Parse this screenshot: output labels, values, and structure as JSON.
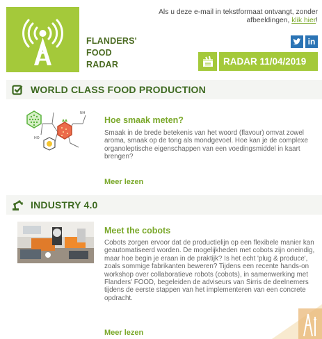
{
  "header": {
    "brand_lines": [
      "FLANDERS'",
      "FOOD",
      "RADAR"
    ],
    "notice_text": "Als u deze e-mail in tekstformaat ontvangt, zonder afbeeldingen,",
    "notice_link": "klik hier",
    "notice_suffix": "!",
    "social": [
      {
        "icon": "twitter-icon",
        "glyph": "🐦"
      },
      {
        "icon": "linkedin-icon",
        "glyph": "in"
      }
    ],
    "radar_label": "RADAR 11/04/2019",
    "logo_icon": "antenna-icon",
    "radar_icon": "calendar-icon"
  },
  "sections": [
    {
      "title": "WORLD CLASS FOOD PRODUCTION",
      "icon": "checkbox-icon",
      "article": {
        "title": "Hoe smaak meten?",
        "body": "Smaak in de brede betekenis van het woord (flavour) omvat zowel aroma, smaak op de tong als mondgevoel. Hoe kan je de complexe organoleptische eigenschappen van een voedingsmiddel in kaart brengen?",
        "more": "Meer lezen"
      }
    },
    {
      "title": "INDUSTRY 4.0",
      "icon": "robot-arm-icon",
      "article": {
        "title": "Meet the cobots",
        "body": "Cobots zorgen ervoor dat de productielijn op een flexibele manier kan geautomatiseerd worden. De mogelijkheden met cobots zijn oneindig, maar hoe begin je eraan in de praktijk? Is het echt 'plug & produce', zoals sommige fabrikanten beweren? Tijdens een recente hands-on workshop over collaboratieve robots (cobots), in samenwerking met Flanders' FOOD, begeleiden de adviseurs van Sirris de deelnemers tijdens de eerste stappen van het implementeren van een concrete opdracht.",
        "more": "Meer lezen"
      }
    }
  ],
  "colors": {
    "brand_green": "#a4c93a",
    "dark_green": "#3e6a21",
    "link_green": "#7aa82a",
    "social_blue": "#2b74b5"
  }
}
